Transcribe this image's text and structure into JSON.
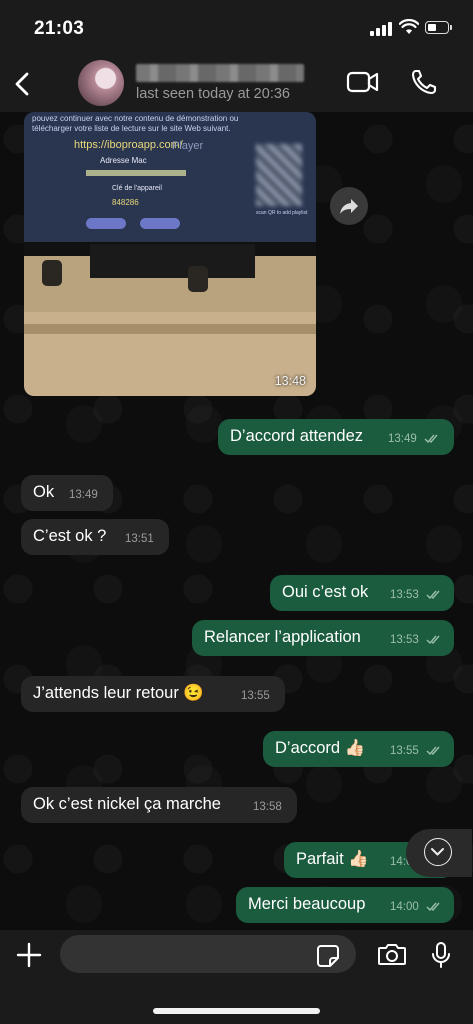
{
  "status_bar": {
    "time": "21:03"
  },
  "header": {
    "last_seen": "last seen today at 20:36",
    "icons": {
      "back": "chevron-left-icon",
      "video": "video-camera-icon",
      "call": "phone-icon"
    }
  },
  "image_message": {
    "time": "13:48",
    "screen_text": {
      "line1": "pouvez continuer avec notre contenu de démonstration ou",
      "line2": "télécharger votre liste de lecture sur le site Web suivant.",
      "url": "https://ibopro​app.com/",
      "brand": "Player",
      "mac_label": "Adresse Mac",
      "key_label": "Clé de l'appareil",
      "device_key": "848286",
      "scan_hint": "scan QR to add playlist"
    }
  },
  "messages": [
    {
      "dir": "out",
      "text": "D’accord attendez",
      "time": "13:49",
      "status": "read"
    },
    {
      "dir": "in",
      "text": "Ok",
      "time": "13:49"
    },
    {
      "dir": "in",
      "text": "C’est ok ?",
      "time": "13:51"
    },
    {
      "dir": "out",
      "text": "Oui c’est ok",
      "time": "13:53",
      "status": "read"
    },
    {
      "dir": "out",
      "text": "Relancer l’application",
      "time": "13:53",
      "status": "read"
    },
    {
      "dir": "in",
      "text": "J’attends leur retour 😉",
      "time": "13:55"
    },
    {
      "dir": "out",
      "text": "D’accord 👍🏻",
      "time": "13:55",
      "status": "read"
    },
    {
      "dir": "in",
      "text": "Ok c’est nickel ça marche",
      "time": "13:58"
    },
    {
      "dir": "out",
      "text": "Parfait 👍🏻",
      "time": "14:00",
      "status": "read"
    },
    {
      "dir": "out",
      "text": "Merci beaucoup",
      "time": "14:00",
      "status": "read"
    }
  ],
  "composer": {
    "icons": {
      "attach": "plus-icon",
      "sticker": "sticker-icon",
      "camera": "camera-icon",
      "mic": "microphone-icon"
    }
  },
  "colors": {
    "incoming": "#262626",
    "outgoing": "#1b5c3e",
    "background": "#0b0b0b"
  }
}
